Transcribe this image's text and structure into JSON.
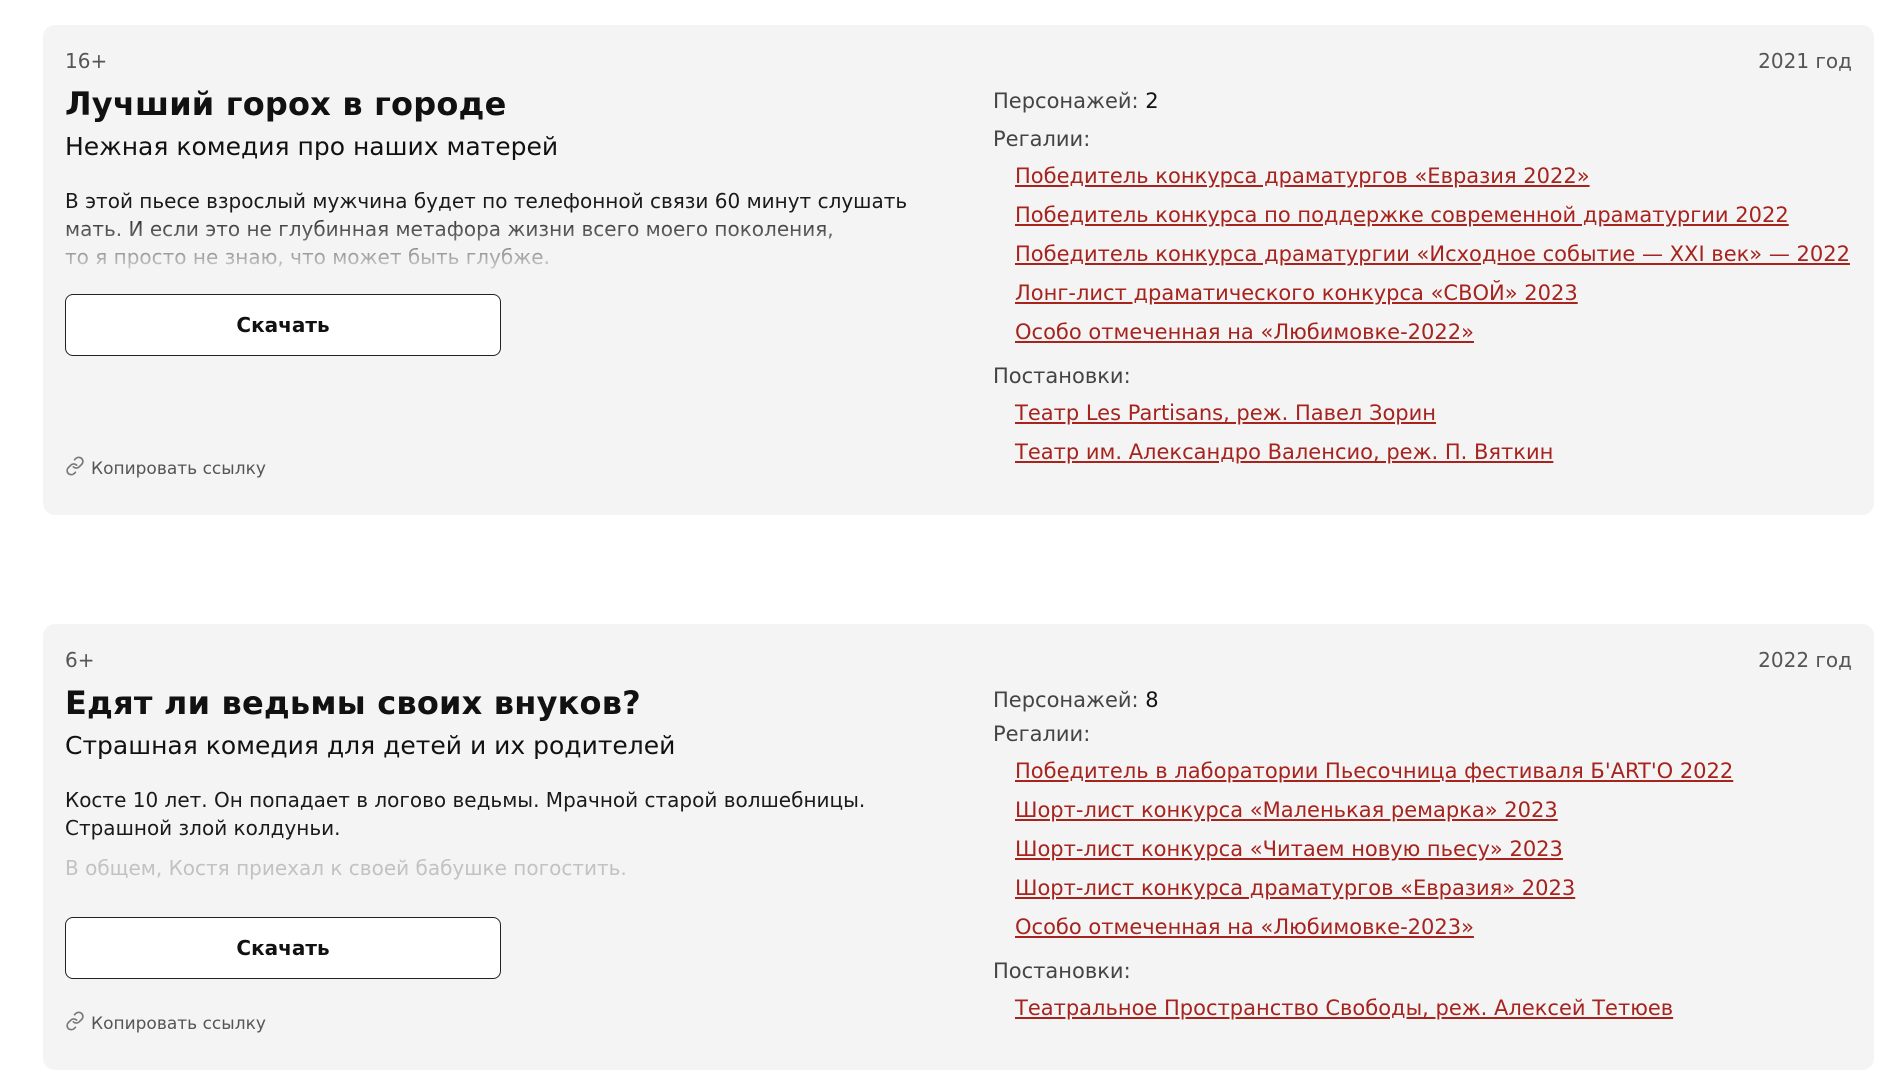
{
  "plays": [
    {
      "age": "16+",
      "year": "2021 год",
      "title": "Лучший горох в городе",
      "subtitle": "Нежная комедия про наших матерей",
      "description_lines": [
        "В этой пьесе взрослый мужчина будет по телефонной связи 60 минут слушать",
        "мать. И если это не глубинная метафора жизни всего моего поколения,",
        "то я просто не знаю, что может быть глубже."
      ],
      "download_label": "Скачать",
      "copy_link_label": "Копировать ссылку",
      "characters_label": "Персонажей:",
      "characters_count": "2",
      "regalia_label": "Регалии:",
      "regalia": [
        "Победитель конкурса драматургов «Евразия 2022»",
        "Победитель конкурса по поддержке современной драматургии 2022",
        "Победитель конкурса драматургии «Исходное событие — XXI век» — 2022",
        "Лонг-лист драматического конкурса «СВОЙ» 2023",
        "Особо отмеченная на «Любимовке-2022»"
      ],
      "productions_label": "Постановки:",
      "productions": [
        "Театр Les Partisans, реж. Павел Зорин",
        "Театр им. Александро Валенсио, реж. П. Вяткин"
      ]
    },
    {
      "age": "6+",
      "year": "2022 год",
      "title": "Едят ли ведьмы своих внуков?",
      "subtitle": "Страшная комедия для детей и их родителей",
      "description_lines": [
        "Косте 10 лет. Он попадает в логово ведьмы. Мрачной старой волшебницы.",
        "Страшной злой колдуньи."
      ],
      "description_faded": "В общем, Костя приехал к своей бабушке погостить.",
      "download_label": "Скачать",
      "copy_link_label": "Копировать ссылку",
      "characters_label": "Персонажей:",
      "characters_count": "8",
      "regalia_label": "Регалии:",
      "regalia": [
        "Победитель в лаборатории Пьесочница фестиваля Б'ART'О 2022",
        "Шорт-лист конкурса «Маленькая ремарка» 2023",
        "Шорт-лист конкурса «Читаем новую пьесу» 2023",
        "Шорт-лист конкурса драматургов «Евразия» 2023",
        "Особо отмеченная на «Любимовке-2023»"
      ],
      "productions_label": "Постановки:",
      "productions": [
        "Театральное Пространство Свободы, реж. Алексей Тетюев"
      ]
    }
  ],
  "colors": {
    "card_bg": "#f4f4f4",
    "link": "#a6231e",
    "text": "#111111",
    "muted": "#555555"
  },
  "icons": {
    "copy_link": "link-icon"
  }
}
